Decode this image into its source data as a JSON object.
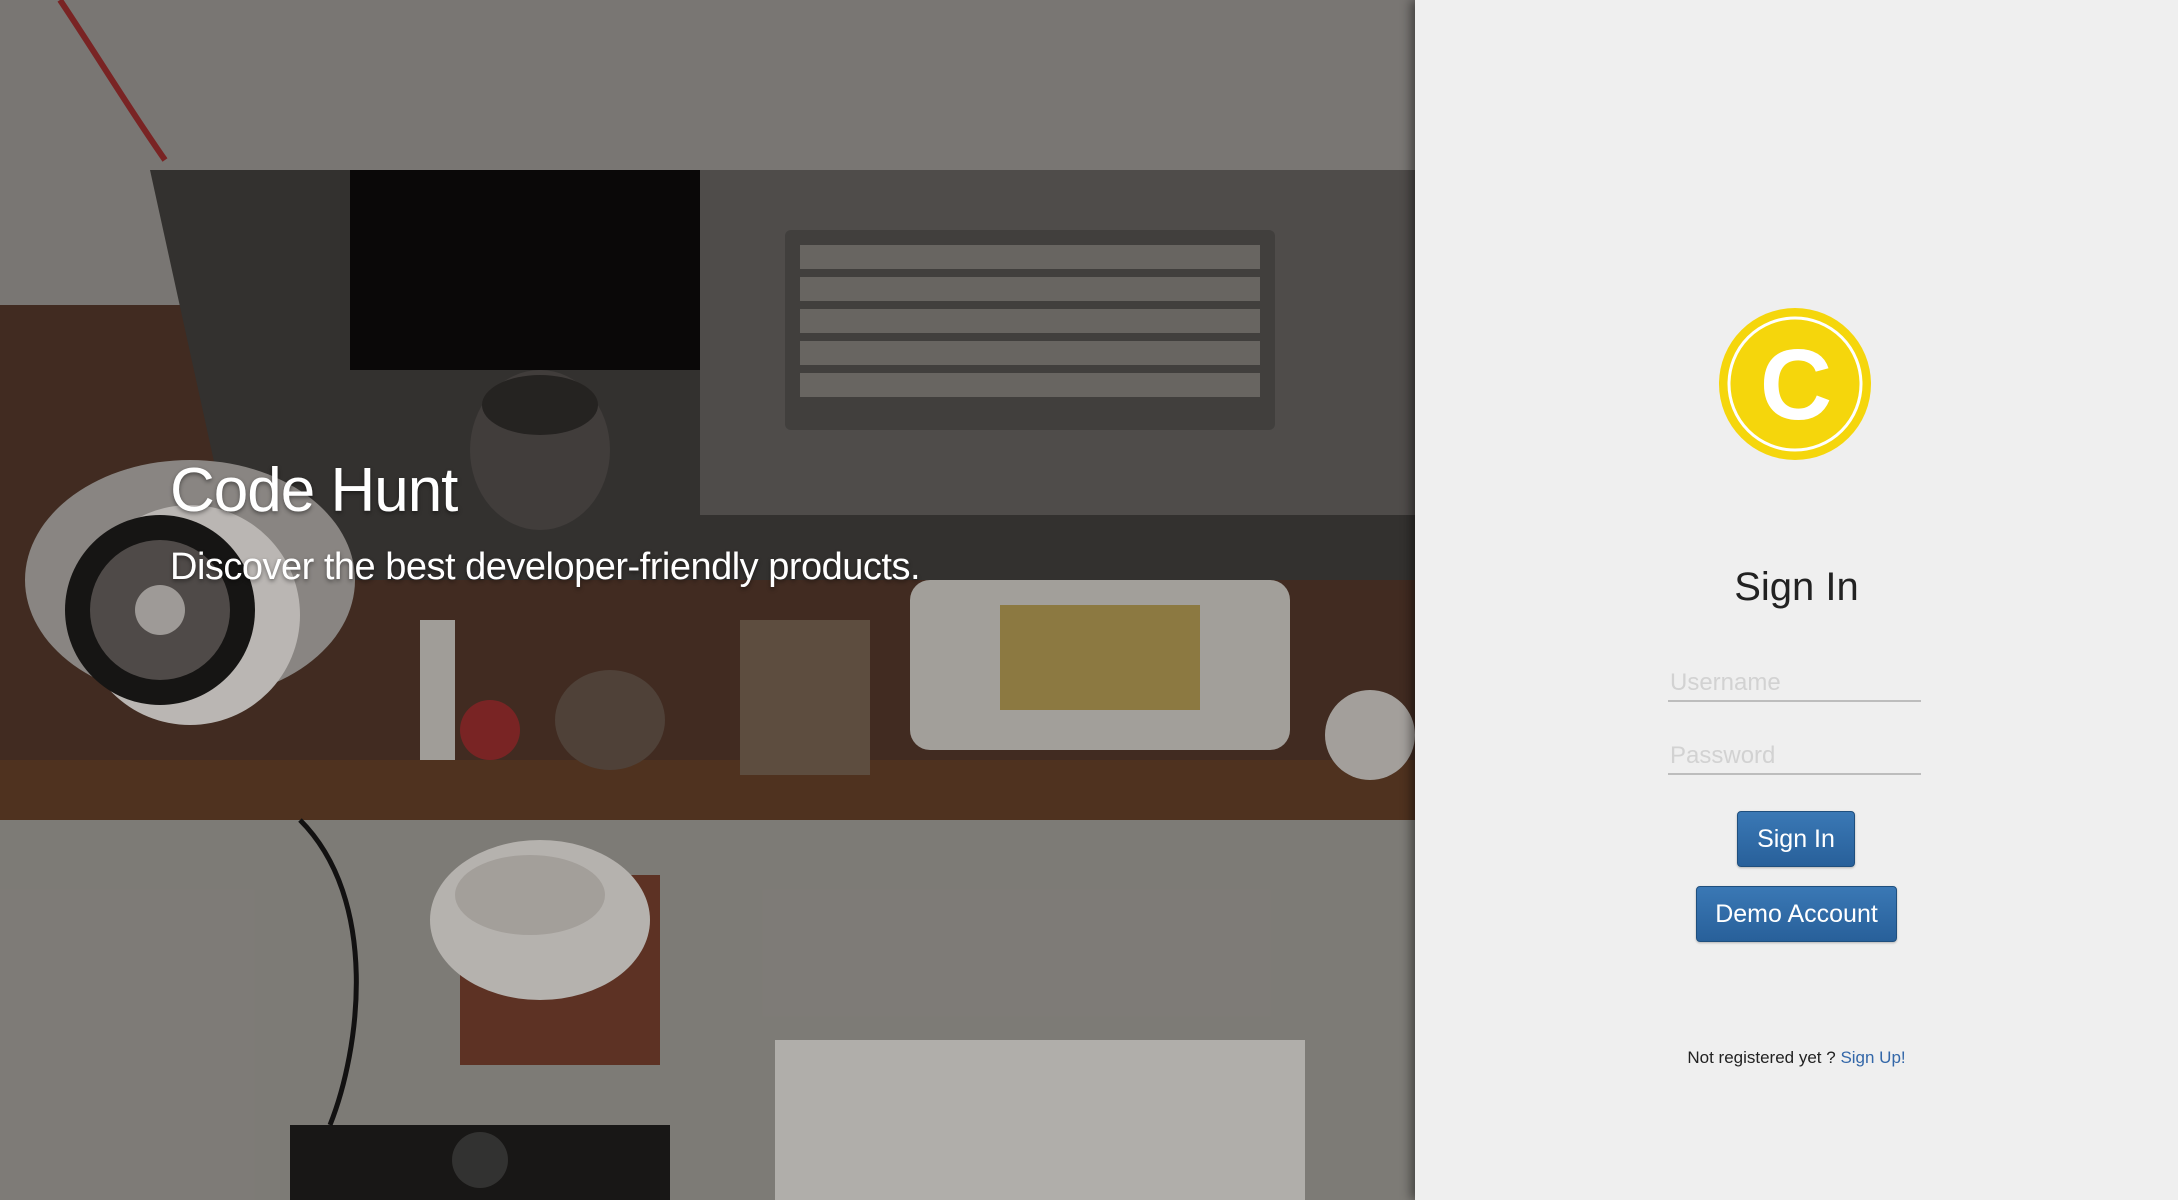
{
  "hero": {
    "title": "Code Hunt",
    "subtitle": "Discover the best developer-friendly products."
  },
  "signin": {
    "logo_icon": "code-hunt-c-logo",
    "logo_letter": "C",
    "title": "Sign In",
    "username_placeholder": "Username",
    "username_value": "",
    "password_placeholder": "Password",
    "password_value": "",
    "signin_button": "Sign In",
    "demo_button": "Demo Account",
    "register_prompt": "Not registered yet ? ",
    "register_link": "Sign Up!"
  },
  "colors": {
    "brand_yellow": "#f5d60c",
    "button_blue": "#2f6aa6",
    "link_blue": "#3367a8",
    "panel_background": "#efefef"
  }
}
